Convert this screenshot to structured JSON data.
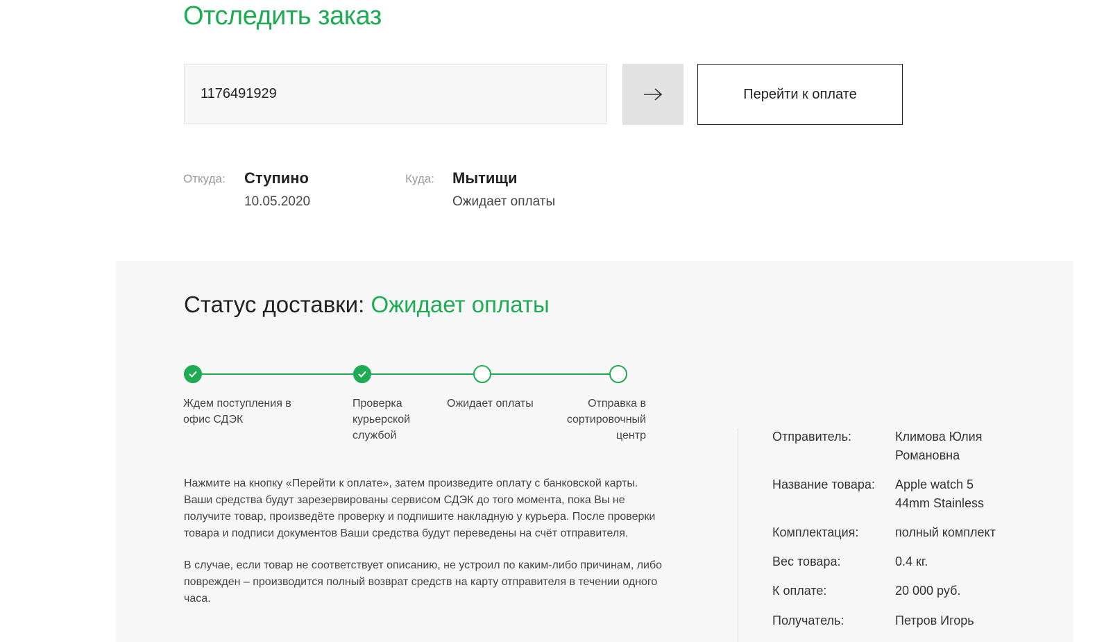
{
  "header": {
    "title": "Отследить заказ"
  },
  "tracking": {
    "value": "1176491929",
    "submit_icon": "arrow-right-icon",
    "pay_label": "Перейти к оплате"
  },
  "route": {
    "from_label": "Откуда:",
    "from_city": "Ступино",
    "from_date": "10.05.2020",
    "to_label": "Куда:",
    "to_city": "Мытищи",
    "to_status": "Ожидает оплаты"
  },
  "status": {
    "heading": "Статус доставки:",
    "value": "Ожидает оплаты"
  },
  "steps": [
    {
      "line1": "Ждем поступления в",
      "line2": "офис СДЭК",
      "line3": "",
      "done": true
    },
    {
      "line1": "Проверка",
      "line2": "курьерской",
      "line3": "службой",
      "done": true
    },
    {
      "line1": "Ожидает оплаты",
      "line2": "",
      "line3": "",
      "done": false
    },
    {
      "line1": "Отправка в",
      "line2": "сортировочный",
      "line3": "центр",
      "done": false
    }
  ],
  "info": {
    "p1": [
      "Нажмите на кнопку «Перейти к оплате», затем произведите оплату с банковской карты.",
      "Ваши средства будут зарезервированы сервисом СДЭК до того момента, пока Вы не",
      "получите товар, произведёте проверку и подпишите накладную у курьера. После проверки",
      "товара и подписи документов Ваши средства будут переведены на счёт отправителя."
    ],
    "p2": [
      "В случае, если товар не соответствует описанию, не устроил по каким-либо причинам, либо",
      "поврежден – производится полный возврат средств на карту отправителя в течении одного",
      "часа."
    ]
  },
  "details": [
    {
      "key": "Отправитель:",
      "line1": "Климова Юлия",
      "line2": "Романовна"
    },
    {
      "key": "Название товара:",
      "line1": "Apple watch 5",
      "line2": "44mm Stainless"
    },
    {
      "key": "Комплектация:",
      "line1": "полный комплект",
      "line2": ""
    },
    {
      "key": "Вес товара:",
      "line1": "0.4 кг.",
      "line2": ""
    },
    {
      "key": "К оплате:",
      "line1": "20 000 руб.",
      "line2": ""
    },
    {
      "key": "Получатель:",
      "line1": "Петров Игорь",
      "line2": ""
    }
  ],
  "colors": {
    "accent": "#1fab54"
  }
}
